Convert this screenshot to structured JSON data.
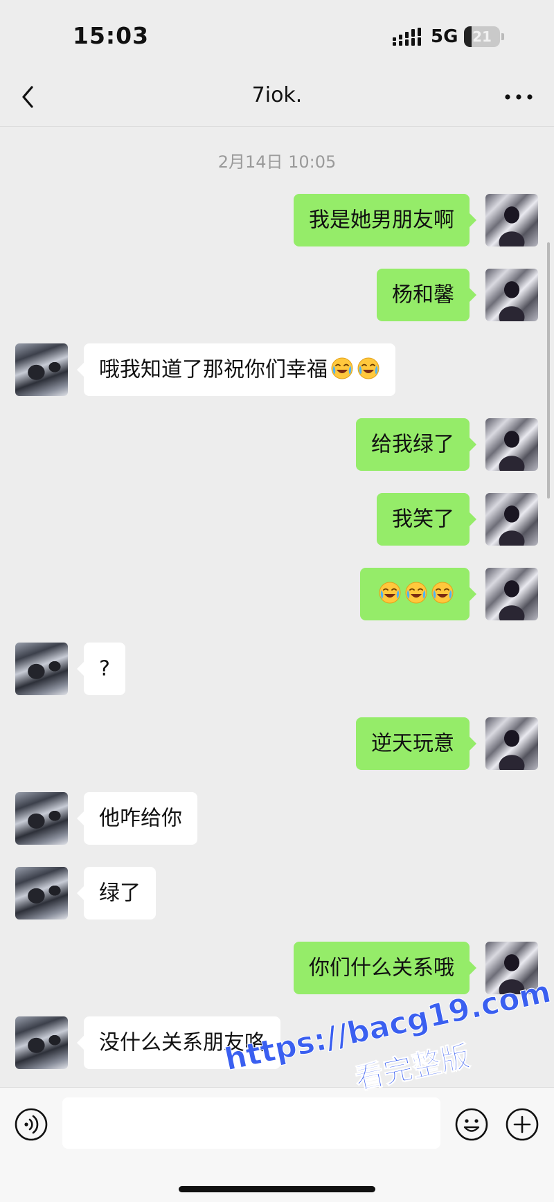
{
  "status_bar": {
    "time": "15:03",
    "network": "5G",
    "battery_level": "21",
    "battery_fraction": 0.21
  },
  "header": {
    "title": "7iok."
  },
  "timestamp": "2月14日 10:05",
  "messages": [
    {
      "side": "sent",
      "text": "我是她男朋友啊",
      "emoji": []
    },
    {
      "side": "sent",
      "text": "杨和馨",
      "emoji": []
    },
    {
      "side": "received",
      "text": "哦我知道了那祝你们幸福",
      "emoji": [
        "laughing-crying-emoji",
        "laughing-crying-emoji"
      ]
    },
    {
      "side": "sent",
      "text": "给我绿了",
      "emoji": []
    },
    {
      "side": "sent",
      "text": "我笑了",
      "emoji": []
    },
    {
      "side": "sent",
      "text": "",
      "emoji": [
        "laughing-crying-emoji",
        "laughing-crying-emoji",
        "laughing-crying-emoji"
      ]
    },
    {
      "side": "received",
      "text": "?",
      "emoji": []
    },
    {
      "side": "sent",
      "text": "逆天玩意",
      "emoji": []
    },
    {
      "side": "received",
      "text": "他咋给你",
      "emoji": []
    },
    {
      "side": "received",
      "text": "绿了",
      "emoji": []
    },
    {
      "side": "sent",
      "text": "你们什么关系哦",
      "emoji": []
    },
    {
      "side": "received",
      "text": "没什么关系朋友咯",
      "emoji": []
    }
  ],
  "input_bar": {
    "value": "",
    "icons": [
      "voice-icon",
      "emoji-face-icon",
      "plus-circle-icon"
    ]
  },
  "watermark": {
    "url": "https://bacg19.com",
    "caption": "看完整版"
  },
  "colors": {
    "background": "#ededed",
    "sent_bubble": "#95ec69",
    "received_bubble": "#ffffff",
    "watermark": "#3a5ff0"
  }
}
